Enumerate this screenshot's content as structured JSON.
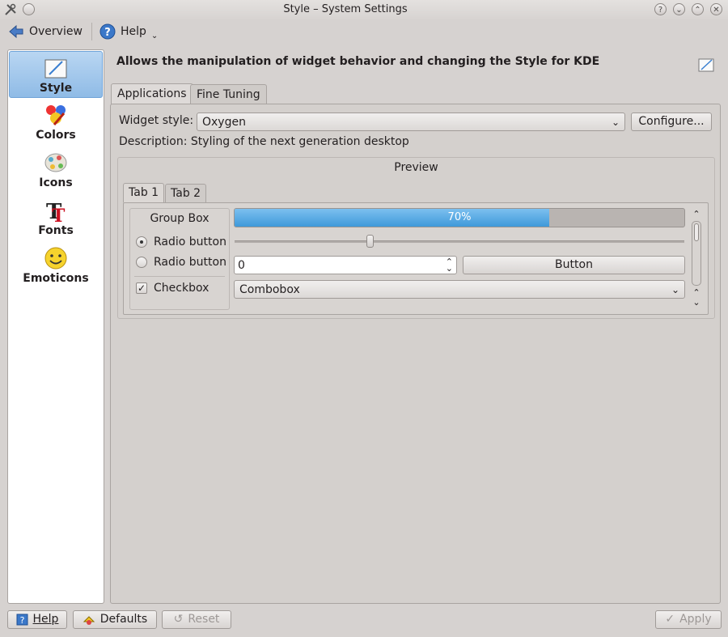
{
  "window": {
    "title": "Style – System Settings"
  },
  "toolbar": {
    "overview_label": "Overview",
    "help_label": "Help"
  },
  "sidebar": {
    "items": [
      {
        "label": "Style"
      },
      {
        "label": "Colors"
      },
      {
        "label": "Icons"
      },
      {
        "label": "Fonts"
      },
      {
        "label": "Emoticons"
      }
    ]
  },
  "header": {
    "text": "Allows the manipulation of widget behavior and changing the Style for KDE"
  },
  "tabs": [
    {
      "label": "Applications"
    },
    {
      "label": "Fine Tuning"
    }
  ],
  "style": {
    "widget_style_label": "Widget style:",
    "widget_style_value": "Oxygen",
    "configure_label": "Configure...",
    "description": "Description: Styling of the next generation desktop"
  },
  "preview": {
    "title": "Preview",
    "tabs": [
      {
        "label": "Tab 1"
      },
      {
        "label": "Tab 2"
      }
    ],
    "group_box_title": "Group Box",
    "radio1": "Radio button",
    "radio2": "Radio button",
    "checkbox": "Checkbox",
    "progress_text": "70%",
    "progress_value": 0.7,
    "slider_value": 0.3,
    "spin_value": "0",
    "button_label": "Button",
    "combobox_value": "Combobox"
  },
  "bottom": {
    "help_label": "Help",
    "defaults_label": "Defaults",
    "reset_label": "Reset",
    "apply_label": "Apply"
  },
  "colors": {
    "accent": "#4a9de0",
    "selection": "#9ec6ec"
  }
}
